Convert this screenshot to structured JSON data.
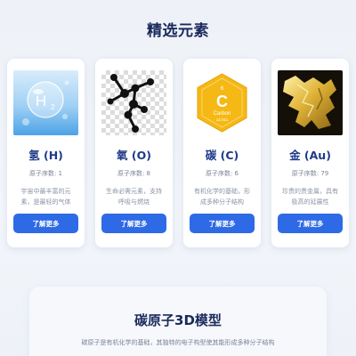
{
  "section": {
    "title": "精选元素"
  },
  "cards": [
    {
      "name": "氢 (H)",
      "atomic_number": "原子序数: 1",
      "description": "宇宙中最丰富的元素，是最轻的气体",
      "button": "了解更多",
      "image_icon": "hydrogen-bubble-icon",
      "image_label": "H",
      "image_sub": "2"
    },
    {
      "name": "氧 (O)",
      "atomic_number": "原子序数: 8",
      "description": "生命必需元素，支持呼吸与燃烧",
      "button": "了解更多",
      "image_icon": "oxygen-molecule-icon"
    },
    {
      "name": "碳 (C)",
      "atomic_number": "原子序数: 6",
      "description": "有机化学的基础，形成多种分子结构",
      "button": "了解更多",
      "image_icon": "carbon-hexagon-icon",
      "image_letter": "C",
      "image_number": "6",
      "image_name": "Carbon",
      "image_mass": "12.011"
    },
    {
      "name": "金 (Au)",
      "atomic_number": "原子序数: 79",
      "description": "珍贵的贵金属，具有极高的延展性",
      "button": "了解更多",
      "image_icon": "gold-nugget-icon"
    }
  ],
  "model": {
    "title": "碳原子3D模型",
    "description": "碳原子是有机化学的基础，其独特的电子构型使其能形成多种分子结构"
  },
  "colors": {
    "accent": "#2e6ae6",
    "title": "#1b2a5c",
    "element_name": "#1e3a8a",
    "carbon_gold": "#f5b814"
  }
}
